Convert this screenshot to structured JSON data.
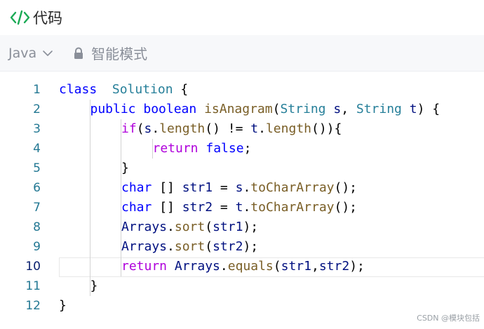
{
  "header": {
    "title": "代码",
    "icon": "code-brackets-icon",
    "icon_color": "#1aaa55"
  },
  "toolbar": {
    "language": "Java",
    "mode_label": "智能模式"
  },
  "editor": {
    "active_line": 10,
    "lines": [
      {
        "n": "1",
        "indent": 0,
        "tokens": [
          [
            "kw",
            "class"
          ],
          [
            "",
            "  "
          ],
          [
            "cls",
            "Solution"
          ],
          [
            "",
            " {"
          ]
        ]
      },
      {
        "n": "2",
        "indent": 1,
        "tokens": [
          [
            "kw",
            "public"
          ],
          [
            "",
            " "
          ],
          [
            "kw",
            "boolean"
          ],
          [
            "",
            " "
          ],
          [
            "fn",
            "isAnagram"
          ],
          [
            "",
            "("
          ],
          [
            "cls",
            "String"
          ],
          [
            "",
            " "
          ],
          [
            "vr",
            "s"
          ],
          [
            "",
            ", "
          ],
          [
            "cls",
            "String"
          ],
          [
            "",
            " "
          ],
          [
            "vr",
            "t"
          ],
          [
            "",
            ") {"
          ]
        ]
      },
      {
        "n": "3",
        "indent": 2,
        "tokens": [
          [
            "kwc",
            "if"
          ],
          [
            "",
            "("
          ],
          [
            "vr",
            "s"
          ],
          [
            "",
            "."
          ],
          [
            "fn",
            "length"
          ],
          [
            "",
            "() != "
          ],
          [
            "vr",
            "t"
          ],
          [
            "",
            "."
          ],
          [
            "fn",
            "length"
          ],
          [
            "",
            "()){"
          ]
        ]
      },
      {
        "n": "4",
        "indent": 3,
        "tokens": [
          [
            "kwc",
            "return"
          ],
          [
            "",
            " "
          ],
          [
            "kw",
            "false"
          ],
          [
            "",
            ";"
          ]
        ]
      },
      {
        "n": "5",
        "indent": 2,
        "tokens": [
          [
            "",
            "}"
          ]
        ]
      },
      {
        "n": "6",
        "indent": 2,
        "tokens": [
          [
            "kw",
            "char"
          ],
          [
            "",
            " [] "
          ],
          [
            "vr",
            "str1"
          ],
          [
            "",
            " = "
          ],
          [
            "vr",
            "s"
          ],
          [
            "",
            "."
          ],
          [
            "fn",
            "toCharArray"
          ],
          [
            "",
            "();"
          ]
        ]
      },
      {
        "n": "7",
        "indent": 2,
        "tokens": [
          [
            "kw",
            "char"
          ],
          [
            "",
            " [] "
          ],
          [
            "vr",
            "str2"
          ],
          [
            "",
            " = "
          ],
          [
            "vr",
            "t"
          ],
          [
            "",
            "."
          ],
          [
            "fn",
            "toCharArray"
          ],
          [
            "",
            "();"
          ]
        ]
      },
      {
        "n": "8",
        "indent": 2,
        "tokens": [
          [
            "vr",
            "Arrays"
          ],
          [
            "",
            "."
          ],
          [
            "fn",
            "sort"
          ],
          [
            "",
            "("
          ],
          [
            "vr",
            "str1"
          ],
          [
            "",
            ");"
          ]
        ]
      },
      {
        "n": "9",
        "indent": 2,
        "tokens": [
          [
            "vr",
            "Arrays"
          ],
          [
            "",
            "."
          ],
          [
            "fn",
            "sort"
          ],
          [
            "",
            "("
          ],
          [
            "vr",
            "str2"
          ],
          [
            "",
            ");"
          ]
        ]
      },
      {
        "n": "10",
        "indent": 2,
        "tokens": [
          [
            "kwc",
            "return"
          ],
          [
            "",
            " "
          ],
          [
            "vr",
            "Arrays"
          ],
          [
            "",
            "."
          ],
          [
            "fn",
            "equals"
          ],
          [
            "",
            "("
          ],
          [
            "vr",
            "str1"
          ],
          [
            "",
            ","
          ],
          [
            "vr",
            "str2"
          ],
          [
            "",
            ");"
          ]
        ]
      },
      {
        "n": "11",
        "indent": 1,
        "tokens": [
          [
            "",
            "}"
          ]
        ]
      },
      {
        "n": "12",
        "indent": 0,
        "tokens": [
          [
            "",
            "}"
          ]
        ]
      }
    ]
  },
  "watermark": "CSDN @模块包括"
}
